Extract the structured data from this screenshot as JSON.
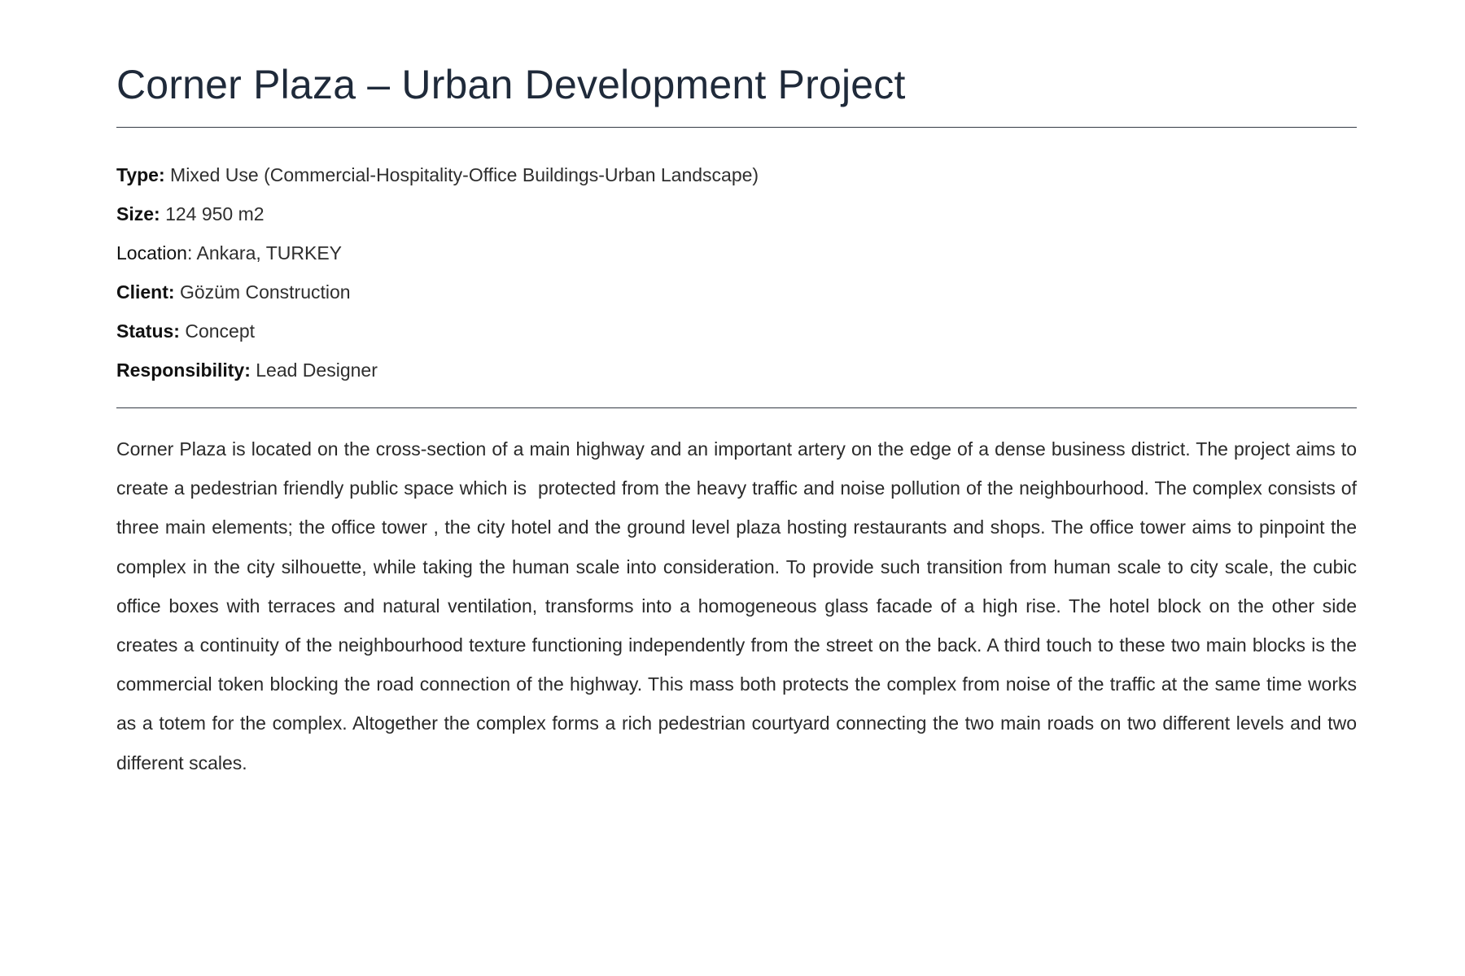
{
  "project": {
    "title": "Corner Plaza – Urban Development Project",
    "details": [
      {
        "label": "Type:",
        "value": " Mixed Use (Commercial-Hospitality-Office Buildings-Urban Landscape)"
      },
      {
        "label": "Size:",
        "value": " 124 950 m2"
      },
      {
        "label": "Location",
        "value": ": Ankara, TURKEY"
      },
      {
        "label": "Client:",
        "value": " Gözüm Construction"
      },
      {
        "label": "Status:",
        "value": " Concept"
      },
      {
        "label": "Responsibility:",
        "value": " Lead Designer"
      }
    ],
    "description": "Corner Plaza is located on the cross-section of a main highway and an important artery on the edge of a dense business district. The project aims to create a pedestrian friendly public space which is  protected from the heavy traffic and noise pollution of the neighbourhood. The complex consists of three main elements; the office tower , the city hotel and the ground level plaza hosting restaurants and shops. The office tower aims to pinpoint the complex in the city silhouette, while taking the human scale into consideration. To provide such transition from human scale to city scale, the cubic office boxes with terraces and natural ventilation, transforms into a homogeneous glass facade of a high rise. The hotel block on the other side creates a continuity of the neighbourhood texture functioning independently from the street on the back. A third touch to these two main blocks is the commercial token blocking the road connection of the highway. This mass both protects the complex from noise of the traffic at the same time works as a totem for the complex. Altogether the complex forms a rich pedestrian courtyard connecting the two main roads on two different levels and two different scales."
  }
}
